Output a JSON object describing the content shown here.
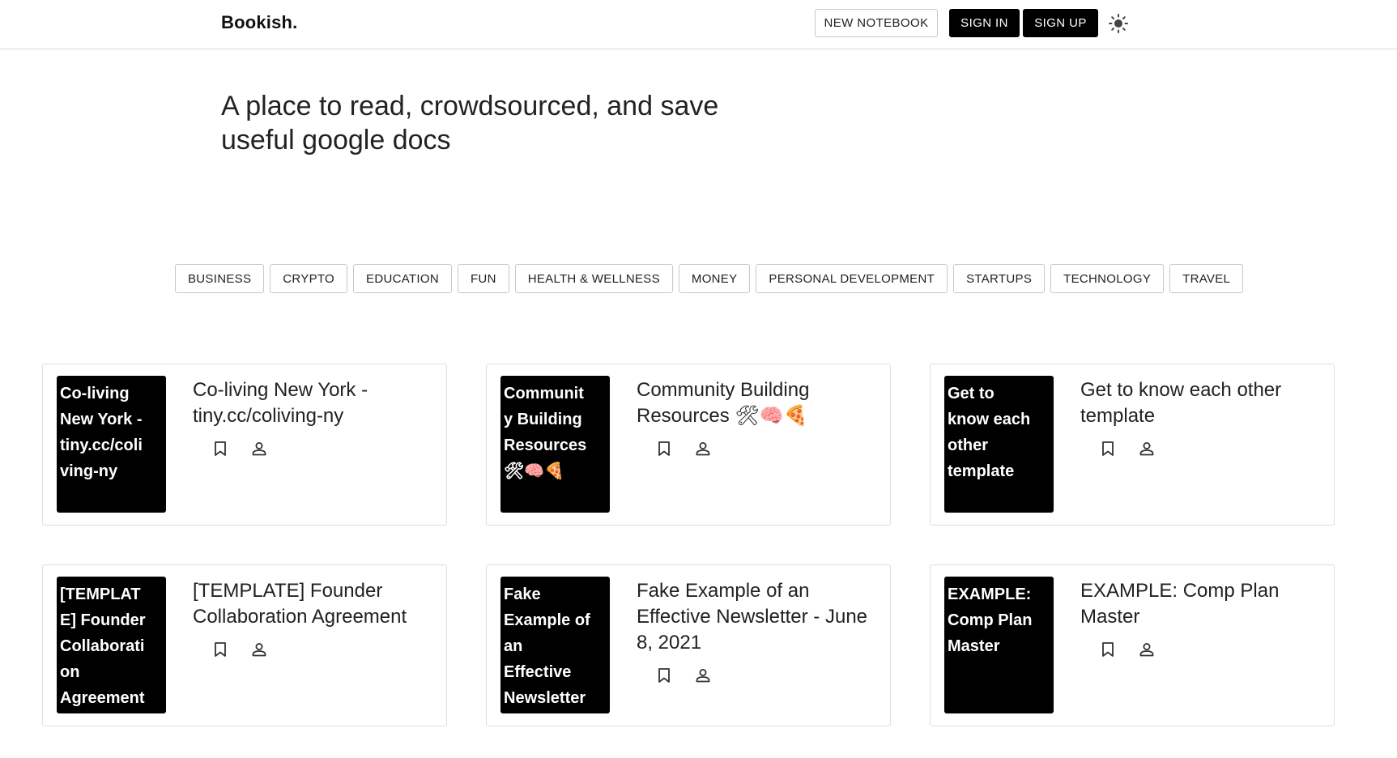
{
  "header": {
    "logo": "Bookish.",
    "new_notebook_label": "NEW NOTEBOOK",
    "sign_in_label": "SIGN IN",
    "sign_up_label": "SIGN UP",
    "theme_icon": "sun-icon"
  },
  "hero": {
    "tagline": "A place to read, crowdsourced, and save useful google docs"
  },
  "categories": [
    "BUSINESS",
    "CRYPTO",
    "EDUCATION",
    "FUN",
    "HEALTH & WELLNESS",
    "MONEY",
    "PERSONAL DEVELOPMENT",
    "STARTUPS",
    "TECHNOLOGY",
    "TRAVEL"
  ],
  "cards": [
    {
      "cover": "Co-living New York - tiny.cc/coliving-ny",
      "title": "Co-living New York - tiny.cc/coliving-ny"
    },
    {
      "cover": "Community Building Resources 🛠🧠🍕",
      "title": "Community Building Resources 🛠🧠🍕"
    },
    {
      "cover": "Get to know each other template",
      "title": "Get to know each other template"
    },
    {
      "cover": "[TEMPLATE] Founder Collaboration Agreement",
      "title": "[TEMPLATE] Founder Collaboration Agreement"
    },
    {
      "cover": "Fake Example of an Effective Newsletter",
      "title": "Fake Example of an Effective Newsletter - June 8, 2021"
    },
    {
      "cover": "EXAMPLE: Comp Plan Master",
      "title": "EXAMPLE: Comp Plan Master"
    }
  ],
  "card_icons": {
    "bookmark": "bookmark-icon",
    "author": "person-icon"
  },
  "colors": {
    "primary": "#000000",
    "background": "#ffffff",
    "border": "#dedede"
  }
}
